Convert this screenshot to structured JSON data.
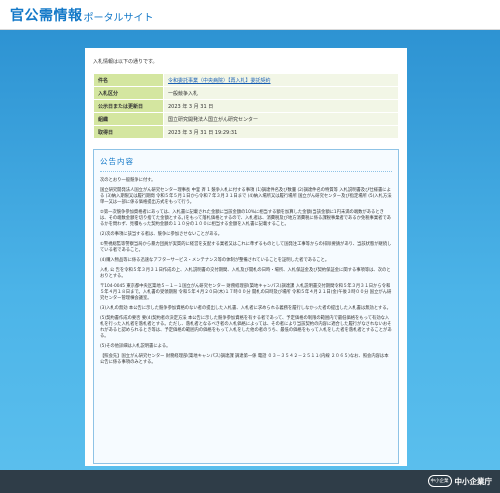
{
  "header": {
    "title_main": "官公需情報",
    "title_sub": "ポータルサイト"
  },
  "intro": "入札情報は以下の通りです。",
  "info": [
    {
      "key": "件名",
      "value": "令和委託事業（中央病院）【再入札】委託契約",
      "is_link": true
    },
    {
      "key": "入札区分",
      "value": "一般競争入札",
      "is_link": false
    },
    {
      "key": "公示日または更新日",
      "value": "2023 年 3 月 31 日",
      "is_link": false
    },
    {
      "key": "組織",
      "value": "国立研究開発法人国立がん研究センター",
      "is_link": false
    },
    {
      "key": "取得日",
      "value": "2023 年 3 月 31 日 19:29:31",
      "is_link": false
    }
  ],
  "content": {
    "title": "公告内容",
    "paragraphs": [
      "次のとおり一般競争に付す。",
      "国立研究開発法人国立がん研究センター理事長 中釜 斉 1 競争入札に付する事項 (1)調達件名及び数量 (2)調達件名の特質等 入札説明書及び仕様書による (3)納入期限又は履行期間 令和５年５月１日から令和７年３月３１日まで (4)納入場所又は履行場所 国立がん研究センター及び指定場所 (5)入札方法 単一又は一部に係る価格提出方式をもって行う。",
      "②第一次競争参加資格者にあっては、入札書に記載された金額に当該金額の10%に相当する額を加算した金額(当該金額に1円未満の端数があるときは、その端数金額を切り捨てた金額とする。)をもって落札価格とするので、入札者は、消費税及び地方消費税に係る課税事業者であるか免税事業者であるかを問わず、見積もった契約金額の１１０分の１００に相当する金額を入札書に記載すること。",
      "(2)次の事項に該当する者は、競争に参加させないことがある。",
      "①警視総監等警察当局から暴力団員が実質的に経営を支配する業者又はこれに準ずるものとして国発注工事等からの排除要請があり、当該状態が継続している者であること。",
      "(4)購入物品等に係る迅速なアフターサービス・メンテナンス等の体制が整備されていることを証明した者であること。",
      "入札 公 告を令和５年３月３１日作成の上、入札説明書の交付期間、入札及び開札の日時・場所、入札保証金及び契約保証金に関する事項等は、次のとおりとする。",
      "〒104-0045 東京都中央区築地５－１－１国立がん研究センター 財務経理部(築地キャンパス)調達課 入札説明書交付期間令和５年３月３１日から令和５年４月１８日まで。入札書の受領期限 令和５年４月２０日(木)１７時００分 開札の日時及び場所 令和５年４月２１日(金)午後３時００分 国立がん研究センター管理棟会議室。",
      "(3)入札の無効 本公告に示した競争参加資格のない者の提出した入札書、入札者に求められる義務を履行しなかった者の提出した入札書は無効とする。",
      "(5)契約書作成の要否 要(4)契約者の決定方法 本公告に示した競争参加資格を有する者であって、予定価格の制限の範囲内で最低価格をもって有効な入札を行った入札者を落札者とする。ただし、落札者となるべき者の入札価格によっては、その者により当該契約の内容に適合した履行がなされないおそれがあると認められるとき等は、予定価格の範囲内の価格をもって入札をした他の者のうち、最低の価格をもって入札をした者を落札者とすることがある。",
      "(5)その他詳細は入札説明書による。",
      "【照会先】国立がん研究センター 財務経理部(築地キャンパス)調達課 調達第一係 電話 ０３－３５４２－２５１１(内線 ２０６５)なお、照会内容は本公告に係る事項のみとする。"
    ]
  },
  "footer": {
    "logo_mark": "中小企業",
    "logo_text": "中小企業庁"
  },
  "colors": {
    "brand_blue": "#1479c8",
    "table_key_bg": "#d4e6a0",
    "footer_bg": "#2f3d48"
  }
}
